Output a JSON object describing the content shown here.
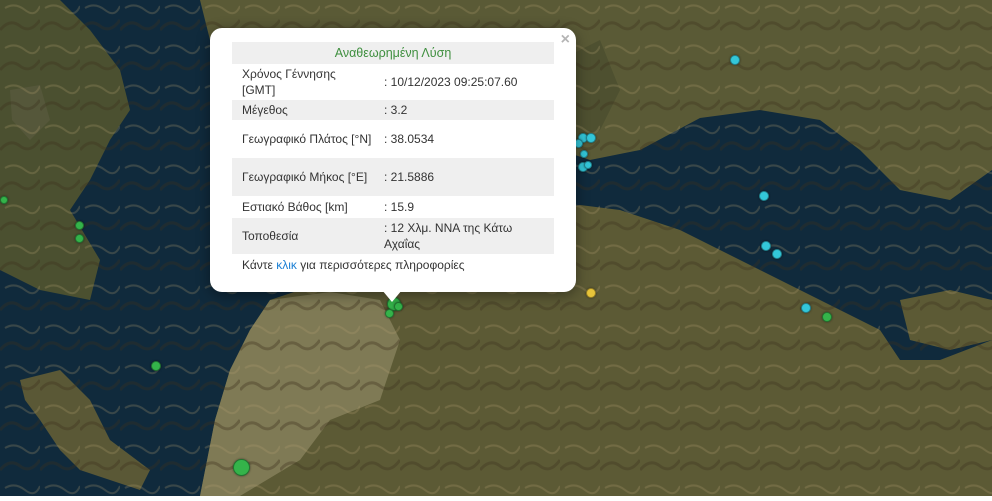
{
  "popup": {
    "title": "Αναθεωρημένη Λύση",
    "close_label": "×",
    "rows": [
      {
        "label": "Χρόνος Γέννησης [GMT]",
        "value": ": 10/12/2023 09:25:07.60"
      },
      {
        "label": "Μέγεθος",
        "value": ": 3.2"
      },
      {
        "label": "Γεωγραφικό Πλάτος [°N]",
        "value": ": 38.0534"
      },
      {
        "label": "Γεωγραφικό Μήκος [°E]",
        "value": ": 21.5886"
      },
      {
        "label": "Εστιακό Βάθος [km]",
        "value": ": 15.9"
      },
      {
        "label": "Τοποθεσία",
        "value": ": 12 Χλμ. NNA της Κάτω Αχαΐας"
      }
    ],
    "more_prefix": "Κάντε",
    "more_link": "κλικ",
    "more_suffix": "για περισσότερες πληροφορίες"
  },
  "colors": {
    "title_green": "#3f8f3f",
    "link_blue": "#1a7fd4",
    "marker_recent": "#33c7d9",
    "marker_older": "#34b34a",
    "marker_mid": "#e7c43a"
  },
  "markers": [
    {
      "color": "cyan",
      "icon": "earthquake-marker-cyan"
    },
    {
      "color": "green",
      "icon": "earthquake-marker-green"
    },
    {
      "color": "yellow",
      "icon": "earthquake-marker-yellow"
    }
  ]
}
